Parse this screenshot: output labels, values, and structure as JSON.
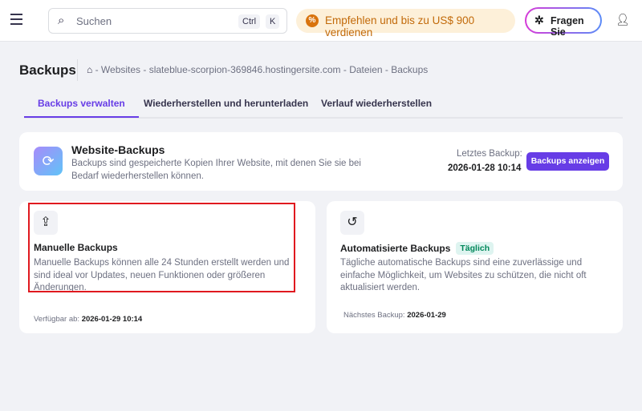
{
  "header": {
    "search_placeholder": "Suchen",
    "kbd_ctrl": "Ctrl",
    "kbd_k": "K",
    "promo": "Empfehlen und bis zu US$ 900 verdienen",
    "ask": "Fragen Sie"
  },
  "page": {
    "title": "Backups",
    "breadcrumb": "- Websites - slateblue-scorpion-369846.hostingersite.com - Dateien - Backups"
  },
  "tabs": [
    "Backups verwalten",
    "Wiederherstellen und herunterladen",
    "Verlauf wiederherstellen"
  ],
  "website_backups": {
    "title": "Website-Backups",
    "description": "Backups sind gespeicherte Kopien Ihrer Website, mit denen Sie sie bei Bedarf wiederherstellen können.",
    "last_label": "Letztes Backup:",
    "last_value": "2026-01-28 10:14",
    "button": "Backups anzeigen"
  },
  "manual": {
    "title": "Manuelle Backups",
    "description": "Manuelle Backups können alle 24 Stunden erstellt werden und sind ideal vor Updates, neuen Funktionen oder größeren Änderungen.",
    "footer_label": "Verfügbar ab:",
    "footer_value": "2026-01-29 10:14"
  },
  "auto": {
    "title": "Automatisierte Backups",
    "badge": "Täglich",
    "description": "Tägliche automatische Backups sind eine zuverlässige und einfache Möglichkeit, um Websites zu schützen, die nicht oft aktualisiert werden.",
    "footer_label": "Nächstes Backup:",
    "footer_value": "2026-01-29"
  }
}
